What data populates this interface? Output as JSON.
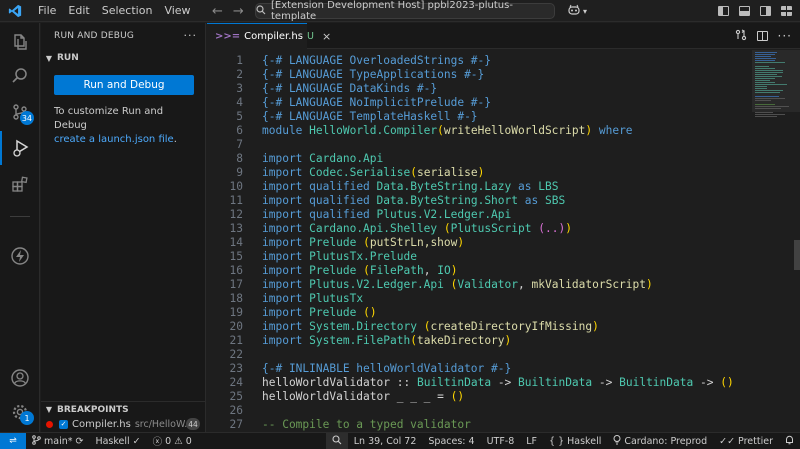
{
  "titlebar": {
    "menu": [
      "File",
      "Edit",
      "Selection",
      "View"
    ],
    "command_center": "[Extension Development Host] ppbl2023-plutus-template"
  },
  "activity_bar": {
    "source_control_badge": "34",
    "accounts_badge": "1"
  },
  "sidebar": {
    "title": "RUN AND DEBUG",
    "section": "RUN",
    "run_button": "Run and Debug",
    "customize_text": "To customize Run and Debug",
    "launch_link": "create a launch.json file",
    "launch_suffix": ".",
    "breakpoints_title": "BREAKPOINTS",
    "breakpoint": {
      "file": "Compiler.hs",
      "path": "src/HelloW...",
      "count": "44"
    }
  },
  "editor": {
    "tab": {
      "name": "Compiler.hs",
      "status": "U"
    },
    "lines": [
      {
        "n": "1"
      },
      {
        "n": "2"
      },
      {
        "n": "3"
      },
      {
        "n": "4"
      },
      {
        "n": "5"
      },
      {
        "n": "6"
      },
      {
        "n": "7"
      },
      {
        "n": "8"
      },
      {
        "n": "9"
      },
      {
        "n": "10"
      },
      {
        "n": "11"
      },
      {
        "n": "12"
      },
      {
        "n": "13"
      },
      {
        "n": "14"
      },
      {
        "n": "15"
      },
      {
        "n": "16"
      },
      {
        "n": "17"
      },
      {
        "n": "18"
      },
      {
        "n": "19"
      },
      {
        "n": "20"
      },
      {
        "n": "21"
      },
      {
        "n": "22"
      },
      {
        "n": "23"
      },
      {
        "n": "24"
      },
      {
        "n": "25"
      },
      {
        "n": "26"
      },
      {
        "n": "27"
      }
    ],
    "code": {
      "l1": "{-# LANGUAGE OverloadedStrings #-}",
      "l2": "{-# LANGUAGE TypeApplications #-}",
      "l3": "{-# LANGUAGE DataKinds #-}",
      "l4": "{-# LANGUAGE NoImplicitPrelude #-}",
      "l5": "{-# LANGUAGE TemplateHaskell #-}",
      "l6_kw": "module",
      "l6_mod": "HelloWorld.Compiler",
      "l6_op": "(",
      "l6_id": "writeHelloWorldScript",
      "l6_cp": ")",
      "l6_where": "where",
      "l8_mod": "Cardano.Api",
      "l9_mod": "Codec.Serialise",
      "l9_id": "serialise",
      "l10_q": "qualified",
      "l10_mod": "Data.ByteString.Lazy",
      "l10_as": "as",
      "l10_alias": "LBS",
      "l11_q": "qualified",
      "l11_mod": "Data.ByteString.Short",
      "l11_as": "as",
      "l11_alias": "SBS",
      "l12_q": "qualified",
      "l12_mod": "Plutus.V2.Ledger.Api",
      "l13_mod": "Cardano.Api.Shelley",
      "l13_type": "PlutusScript",
      "l13_dots": "(..)",
      "l14_mod": "Prelude",
      "l14_ids": "putStrLn,show",
      "l15_mod": "PlutusTx.Prelude",
      "l16_mod": "Prelude",
      "l16_type": "FilePath",
      "l16_sep": ", ",
      "l16_io": "IO",
      "l17_mod": "Plutus.V2.Ledger.Api",
      "l17_type": "Validator",
      "l17_sep": ", ",
      "l17_id": "mkValidatorScript",
      "l18_mod": "PlutusTx",
      "l19_mod": "Prelude",
      "l19_unit": "()",
      "l20_mod": "System.Directory",
      "l20_id": "createDirectoryIfMissing",
      "l21_mod": "System.FilePath",
      "l21_id": "takeDirectory",
      "l23": "{-# INLINABLE helloWorldValidator #-}",
      "l24_fn": "helloWorldValidator",
      "l24_sig": "::",
      "l24_t1": "BuiltinData",
      "l24_arrow": "->",
      "l24_unit": "()",
      "l25_fn": "helloWorldValidator",
      "l25_args": "_ _ _ =",
      "l25_unit": "()",
      "l27": "-- Compile to a typed validator",
      "import_kw": "import"
    }
  },
  "statusbar": {
    "branch": "main*",
    "haskell": "Haskell",
    "check": "✓",
    "errors": "0",
    "warnings": "0",
    "position": "Ln 39, Col 72",
    "spaces": "Spaces: 4",
    "encoding": "UTF-8",
    "eol": "LF",
    "language": "Haskell",
    "network": "Cardano: Preprod",
    "formatter": "Prettier"
  },
  "colors": {
    "accent": "#0078d4",
    "keyword": "#569cd6",
    "module": "#4ec9b0",
    "function": "#dcdcaa",
    "comment": "#6a9955",
    "untracked": "#73c991"
  }
}
